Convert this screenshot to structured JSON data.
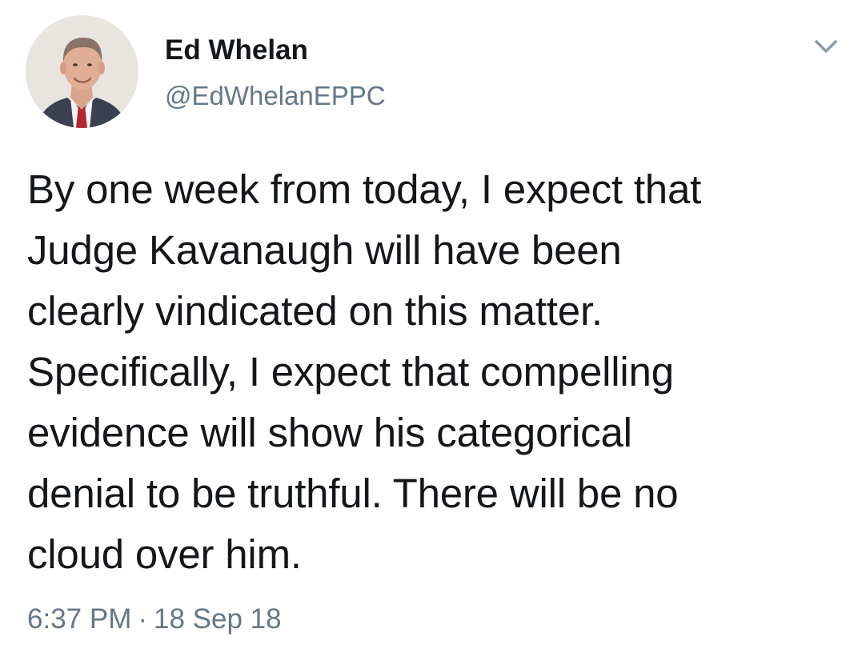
{
  "author": {
    "display_name": "Ed Whelan",
    "handle": "@EdWhelanEPPC",
    "avatar_icon": "profile-photo"
  },
  "menu": {
    "icon": "chevron-down-icon"
  },
  "tweet": {
    "text": "By one week from today, I expect that\nJudge Kavanaugh will have been\nclearly vindicated on this matter.\nSpecifically, I expect that compelling\nevidence will show his categorical\ndenial to be truthful. There will be no\ncloud over him.",
    "time": "6:37 PM",
    "separator": "·",
    "date": "18 Sep 18"
  },
  "colors": {
    "text_primary": "#14171a",
    "text_secondary": "#657786",
    "background": "#ffffff",
    "caret": "#8899a6"
  }
}
